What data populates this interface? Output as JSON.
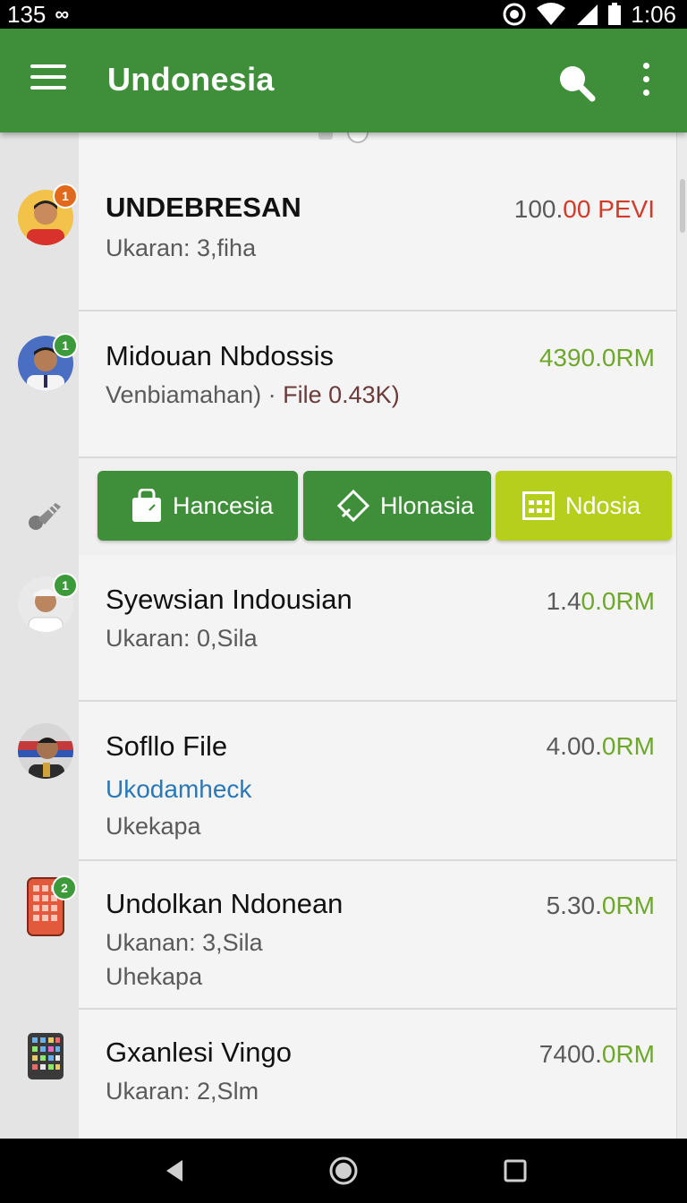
{
  "status_bar": {
    "time_left": "135",
    "clock": "1:06"
  },
  "app_bar": {
    "title": "Undonesia"
  },
  "rows": [
    {
      "name": "UNDEBRESAN",
      "sub": "Ukaran: 3,fiha",
      "price_a": "100.",
      "price_b": "00 PEVI"
    },
    {
      "name": "Midouan Nbdossis",
      "sub_a": "Venbiamahan) · ",
      "sub_b": "File 0.43K)",
      "price": "4390.0RM"
    },
    {
      "name": "Syewsian Indousian",
      "sub": "Ukaran: 0,Sila",
      "price_a": "1.4",
      "price_b": "0.0RM"
    },
    {
      "name": "Sofllo File",
      "link": "Ukodamheck",
      "sub2": "Ukekapa",
      "price_a": "4.00.",
      "price_b": "0RM"
    },
    {
      "name": "Undolkan Ndonean",
      "sub": "Ukanan: 3,Sila",
      "sub2": "Uhekapa",
      "price_a": "5.30.",
      "price_b": "0RM"
    },
    {
      "name": "Gxanlesi Vingo",
      "sub": "Ukaran: 2,Slm",
      "price_a": "7400.",
      "price_b": "0RM"
    }
  ],
  "actions": [
    {
      "label": "Hancesia",
      "icon": "bag-icon"
    },
    {
      "label": "Hlonasia",
      "icon": "diamond-icon"
    },
    {
      "label": "Ndosia",
      "icon": "grid-icon"
    }
  ],
  "badges": [
    "1",
    "1",
    "1",
    "2"
  ],
  "colors": {
    "primary": "#3f8f3a",
    "accent_lime": "#b6cf1c",
    "price_red": "#d23a2a",
    "price_green": "#6ea82a",
    "link_blue": "#2a78b6"
  }
}
